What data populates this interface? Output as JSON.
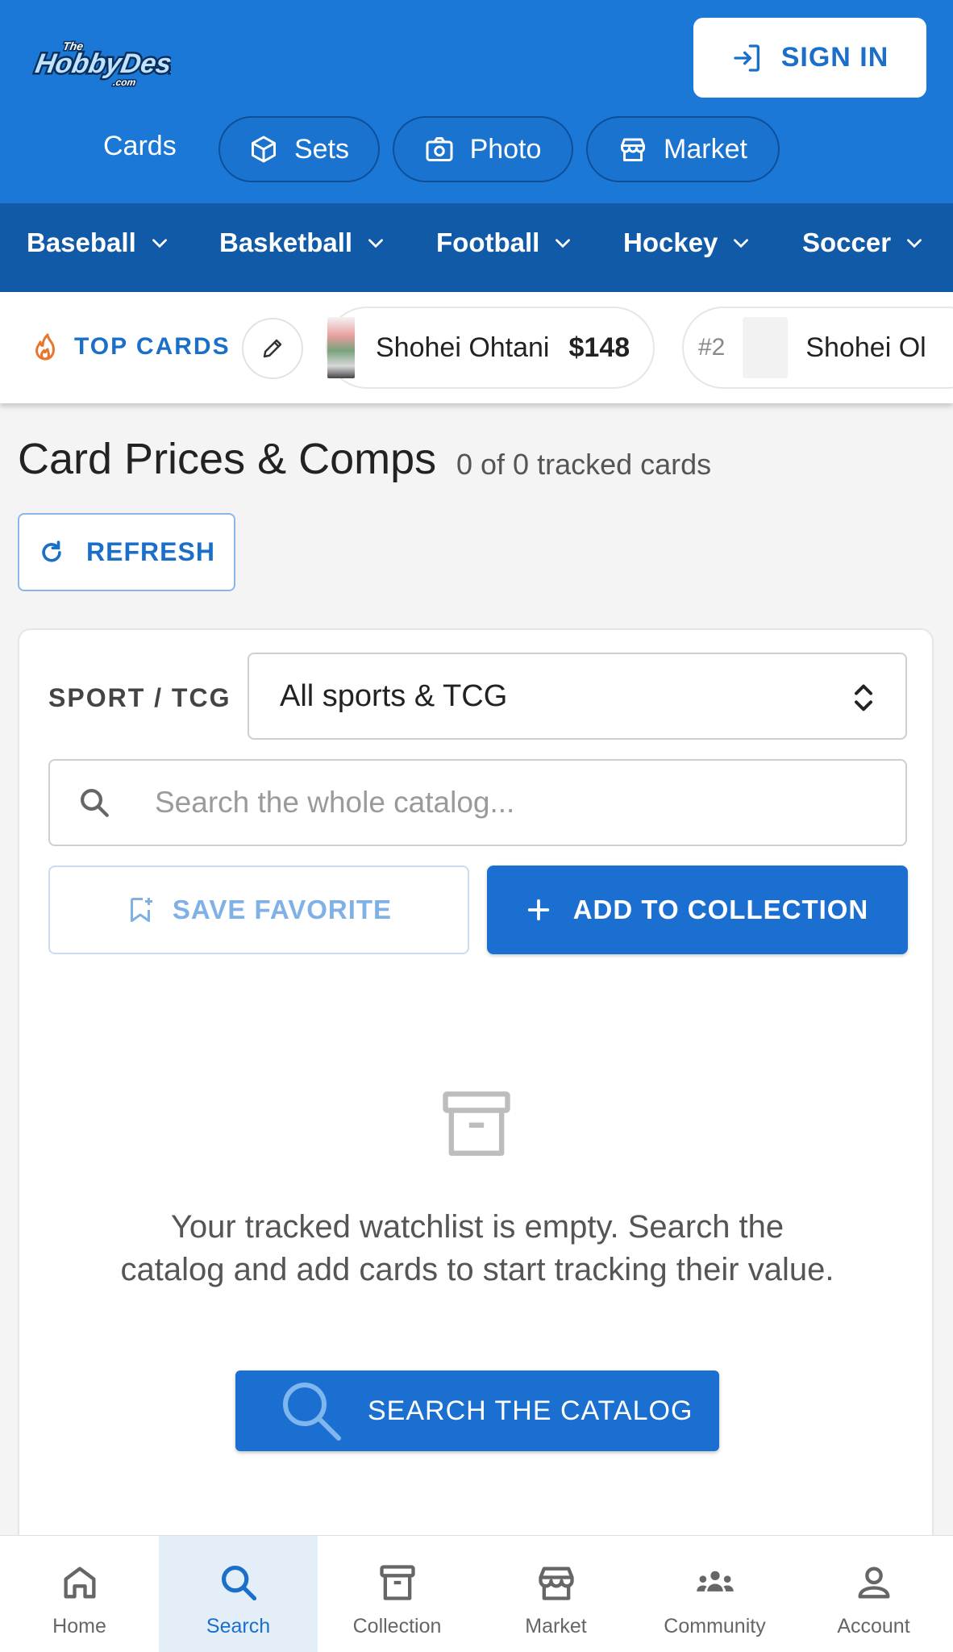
{
  "header": {
    "logo_text": "TheHobbyDesk.com",
    "sign_in_label": "SIGN IN",
    "nav": [
      {
        "label": "Cards",
        "icon": "none"
      },
      {
        "label": "Sets",
        "icon": "cube-icon"
      },
      {
        "label": "Photo",
        "icon": "camera-icon"
      },
      {
        "label": "Market",
        "icon": "store-icon"
      }
    ]
  },
  "sports": [
    "Baseball",
    "Basketball",
    "Football",
    "Hockey",
    "Soccer"
  ],
  "top_cards": {
    "label": "TOP CARDS",
    "items": [
      {
        "rank": "",
        "name": "Shohei Ohtani",
        "price": "$148"
      },
      {
        "rank": "#2",
        "name": "Shohei Ol",
        "price": ""
      }
    ]
  },
  "main": {
    "title": "Card Prices & Comps",
    "tracked_count": "0 of 0 tracked cards",
    "refresh_label": "REFRESH"
  },
  "filters": {
    "sport_label": "SPORT / TCG",
    "sport_value": "All sports & TCG",
    "search_placeholder": "Search the whole catalog...",
    "save_favorite_label": "SAVE FAVORITE",
    "add_collection_label": "ADD TO COLLECTION"
  },
  "empty_state": {
    "message": "Your tracked watchlist is empty. Search the catalog and add cards to start tracking their value.",
    "button_label": "SEARCH THE CATALOG"
  },
  "bottom_nav": [
    {
      "label": "Home",
      "icon": "home-icon",
      "active": false
    },
    {
      "label": "Search",
      "icon": "search-icon",
      "active": true
    },
    {
      "label": "Collection",
      "icon": "archive-icon",
      "active": false
    },
    {
      "label": "Market",
      "icon": "store-icon",
      "active": false
    },
    {
      "label": "Community",
      "icon": "people-icon",
      "active": false
    },
    {
      "label": "Account",
      "icon": "person-icon",
      "active": false
    }
  ],
  "colors": {
    "header_blue": "#1b78d6",
    "sport_nav_blue": "#115aa8",
    "accent_blue": "#1b6fd0",
    "fire_orange": "#e8752a"
  }
}
